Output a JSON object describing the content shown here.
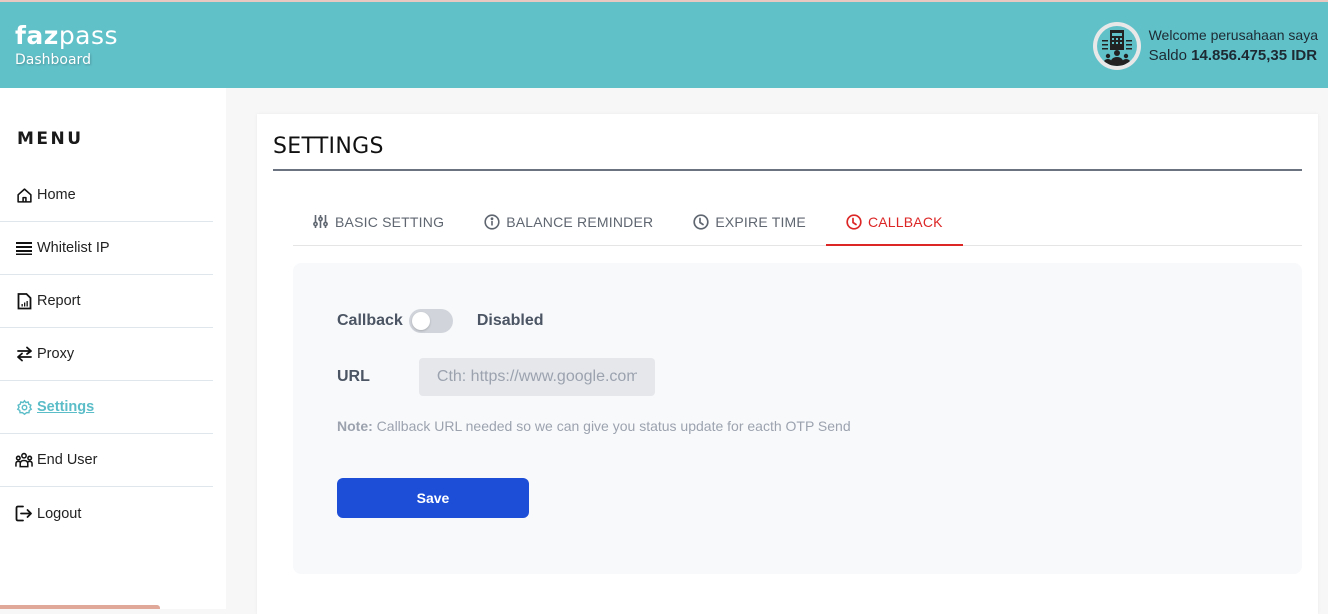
{
  "header": {
    "logo_bold": "faz",
    "logo_light": "pass",
    "subtitle": "Dashboard",
    "welcome": "Welcome perusahaan saya",
    "saldo_label": "Saldo",
    "saldo_value": "14.856.475,35 IDR",
    "avatar_icon": "company-building-icon"
  },
  "sidebar": {
    "title": "MENU",
    "items": [
      {
        "label": "Home",
        "icon": "home-icon",
        "active": false
      },
      {
        "label": "Whitelist IP",
        "icon": "list-icon",
        "active": false
      },
      {
        "label": "Report",
        "icon": "report-icon",
        "active": false
      },
      {
        "label": "Proxy",
        "icon": "swap-icon",
        "active": false
      },
      {
        "label": "Settings",
        "icon": "gear-icon",
        "active": true
      },
      {
        "label": "End User",
        "icon": "users-icon",
        "active": false
      },
      {
        "label": "Logout",
        "icon": "logout-icon",
        "active": false
      }
    ]
  },
  "main": {
    "title": "SETTINGS",
    "tabs": [
      {
        "label": "BASIC SETTING",
        "icon": "sliders-icon",
        "active": false
      },
      {
        "label": "BALANCE REMINDER",
        "icon": "info-icon",
        "active": false
      },
      {
        "label": "EXPIRE TIME",
        "icon": "clock-icon",
        "active": false
      },
      {
        "label": "CALLBACK",
        "icon": "clock-icon",
        "active": true
      }
    ],
    "callback": {
      "label": "Callback",
      "enabled": false,
      "status": "Disabled",
      "url_label": "URL",
      "url_value": "",
      "url_placeholder": "Cth: https://www.google.com",
      "note_label": "Note:",
      "note_text": " Callback URL needed so we can give you status update for eacth OTP Send",
      "save_label": "Save"
    }
  },
  "colors": {
    "header_bg": "#61c1c9",
    "active_menu": "#5bbdc8",
    "active_tab": "#dc2626",
    "save_button": "#1d4ed8"
  }
}
